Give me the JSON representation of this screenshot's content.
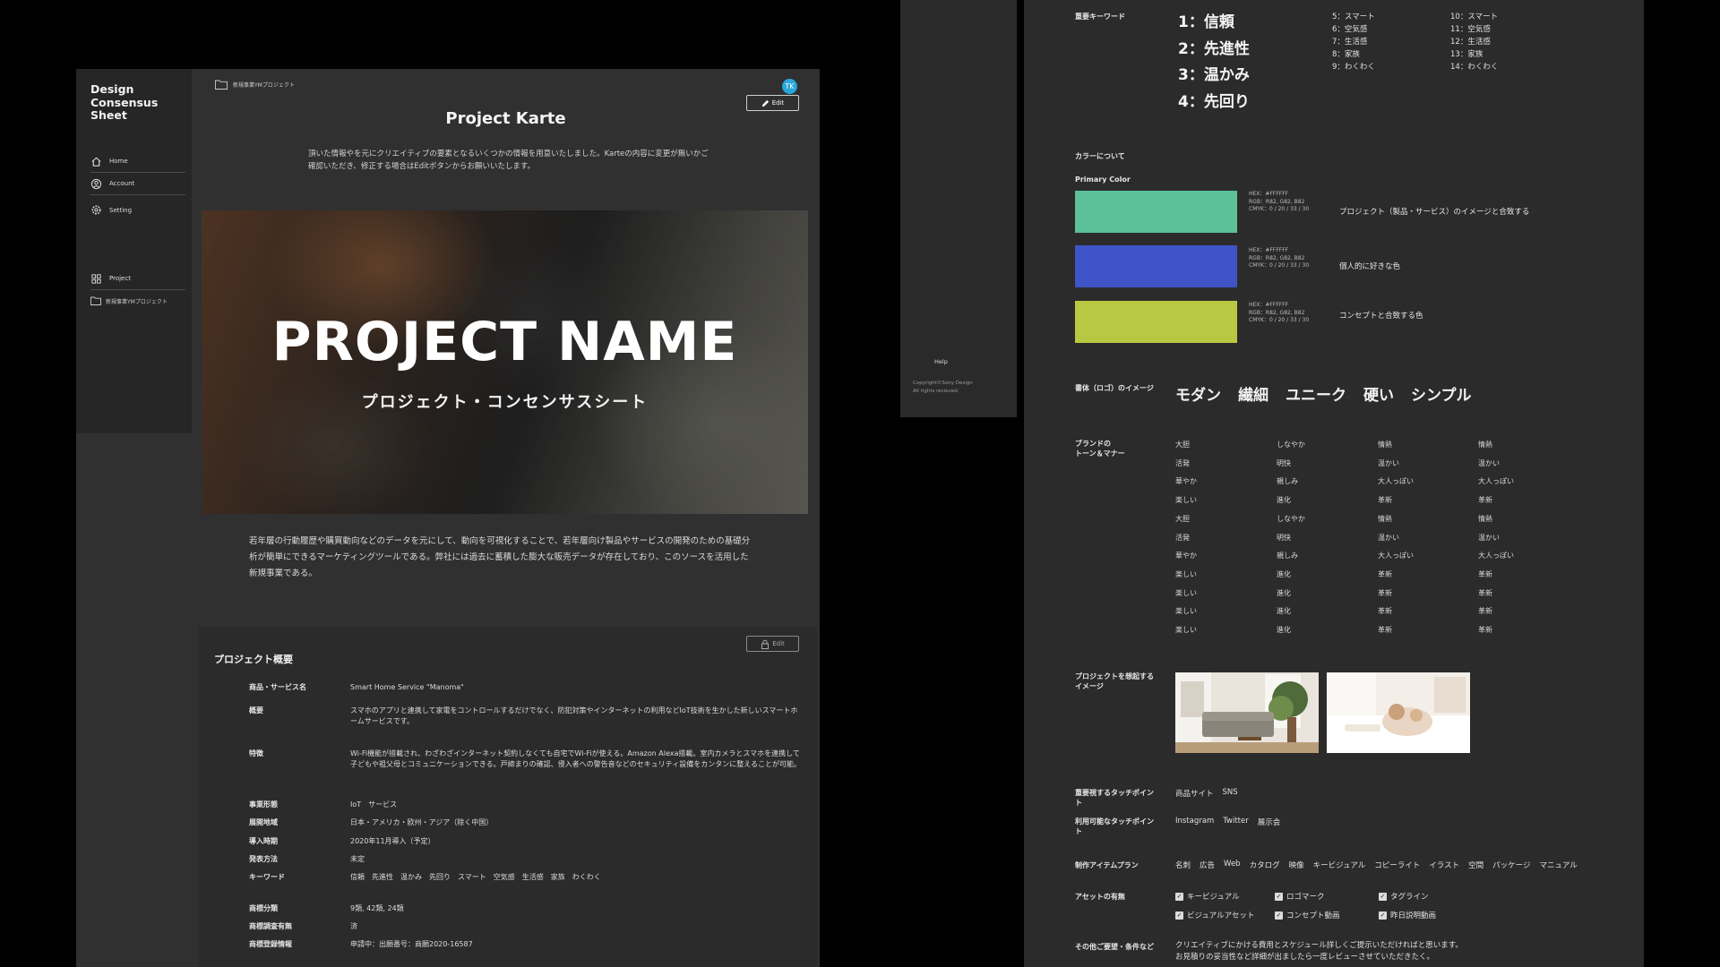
{
  "sidebar": {
    "brand": "Design\nConsensus\nSheet",
    "items": [
      {
        "label": "Home",
        "icon": "home-icon"
      },
      {
        "label": "Account",
        "icon": "account-icon"
      },
      {
        "label": "Setting",
        "icon": "gear-icon"
      },
      {
        "label": "Project",
        "icon": "grid-icon"
      }
    ],
    "sub_project": "新規事業YMプロジェクト"
  },
  "header": {
    "breadcrumb": "新規事業YMプロジェクト",
    "avatar": "TK",
    "edit_label": "Edit",
    "title": "Project Karte"
  },
  "intro": "頂いた情報やを元にクリエイティブの要素となるいくつかの情報を用意いたしました。Karteの内容に変更が無いかご確認いただき、修正する場合はEditボタンからお願いいたします。",
  "hero": {
    "title": "PROJECT NAME",
    "subtitle": "プロジェクト・コンセンサスシート"
  },
  "description": "若年層の行動履歴や購買動向などのデータを元にして、動向を可視化することで、若年層向け製品やサービスの開発のための基礎分析が簡単にできるマーケティングツールである。弊社には過去に蓄積した膨大な販売データが存在しており、このソースを活用した新規事業である。",
  "overview": {
    "title": "プロジェクト概要",
    "edit_label": "Edit",
    "rows": [
      {
        "label": "商品・サービス名",
        "value": "Smart Home Service \"Manoma\""
      },
      {
        "label": "概要",
        "value": "スマホのアプリと連携して家電をコントロールするだけでなく、防犯対策やインターネットの利用などIoT技術を生かした新しいスマートホームサービスです。"
      },
      {
        "label": "特徴",
        "value": "Wi-Fi機能が搭載され、わざわざインターネット契約しなくても自宅でWi-Fiが使える。Amazon Alexa搭載。室内カメラとスマホを連携して子どもや祖父母とコミュニケーションできる。戸締まりの確認、侵入者への警告音などのセキュリティ設備をカンタンに整えることが可能。"
      },
      {
        "label": "事業形態",
        "value": "IoT　サービス"
      },
      {
        "label": "展開地域",
        "value": "日本・アメリカ・欧州・アジア（除く中国）"
      },
      {
        "label": "導入時期",
        "value": "2020年11月導入（予定）"
      },
      {
        "label": "発表方法",
        "value": "未定"
      },
      {
        "label": "キーワード",
        "value": "信頼　先進性　温かみ　先回り　スマート　空気感　生活感　家族　わくわく"
      },
      {
        "label": "商標分類",
        "value": "9類, 42類, 24類"
      },
      {
        "label": "商標調査有無",
        "value": "済"
      },
      {
        "label": "商標登録情報",
        "value": "申請中：出願番号：商願2020-16587"
      }
    ]
  },
  "mid": {
    "help": "Help",
    "copyright": "Copyright©Sony Design\nAll rights recieved."
  },
  "right": {
    "keywords_label": "重要キーワード",
    "keywords_main": [
      "1：信頼",
      "2：先進性",
      "3：温かみ",
      "4：先回り"
    ],
    "keywords_col1": [
      "5：スマート",
      "6：空気感",
      "7：生活感",
      "8：家族",
      "9：わくわく"
    ],
    "keywords_col2": [
      "10：スマート",
      "11：空気感",
      "12：生活感",
      "13：家族",
      "14：わくわく"
    ],
    "color_label": "カラーについて",
    "primary_label": "Primary Color",
    "swatches": [
      {
        "color": "#5cc098",
        "meta": "HEX：#FFFFFF\nRGB：R82, G82, B82\nCMYK：0 / 20 / 33 / 30",
        "desc": "プロジェクト（製品・サービス）のイメージと合致する"
      },
      {
        "color": "#3f54c6",
        "meta": "HEX：#FFFFFF\nRGB：R82, G82, B82\nCMYK：0 / 20 / 33 / 30",
        "desc": "個人的に好きな色"
      },
      {
        "color": "#b9c842",
        "meta": "HEX：#FFFFFF\nRGB：R82, G82, B82\nCMYK：0 / 20 / 33 / 30",
        "desc": "コンセプトと合致する色"
      }
    ],
    "font_label": "書体（ロゴ）のイメージ",
    "font_words": [
      "モダン",
      "繊細",
      "ユニーク",
      "硬い",
      "シンプル"
    ],
    "tone_label": "ブランドの\nトーン＆マナー",
    "tone_cols": [
      [
        "大胆",
        "活発",
        "華やか",
        "楽しい",
        "大胆",
        "活発",
        "華やか",
        "楽しい",
        "楽しい",
        "楽しい",
        "楽しい"
      ],
      [
        "しなやか",
        "明快",
        "親しみ",
        "進化",
        "しなやか",
        "明快",
        "親しみ",
        "進化",
        "進化",
        "進化",
        "進化"
      ],
      [
        "情熱",
        "温かい",
        "大人っぽい",
        "革新",
        "情熱",
        "温かい",
        "大人っぽい",
        "革新",
        "革新",
        "革新",
        "革新"
      ],
      [
        "情熱",
        "温かい",
        "大人っぽい",
        "革新",
        "情熱",
        "温かい",
        "大人っぽい",
        "革新",
        "革新",
        "革新",
        "革新"
      ]
    ],
    "image_label": "プロジェクトを想起する\nイメージ",
    "touch_label": "重要視するタッチポイン\nト",
    "touch_values": [
      "商品サイト",
      "SNS"
    ],
    "avail_label": "利用可能なタッチポイン\nト",
    "avail_values": [
      "Instagram",
      "Twitter",
      "展示会"
    ],
    "items_label": "制作アイテムプラン",
    "items_values": [
      "名刺",
      "広告",
      "Web",
      "カタログ",
      "映像",
      "キービジュアル",
      "コピーライト",
      "イラスト",
      "空間",
      "パッケージ",
      "マニュアル"
    ],
    "assets_label": "アセットの有無",
    "assets": [
      "キービジュアル",
      "ロゴマーク",
      "タグライン",
      "ビジュアルアセット",
      "コンセプト動画",
      "昨日説明動画"
    ],
    "other_label": "その他ご要望・条件など",
    "other_text": "クリエイティブにかける費用とスケジュール詳しくご提示いただければと思います。\nお見積りの妥当性など詳細が出ましたら一度レビューさせていただきたく。"
  }
}
